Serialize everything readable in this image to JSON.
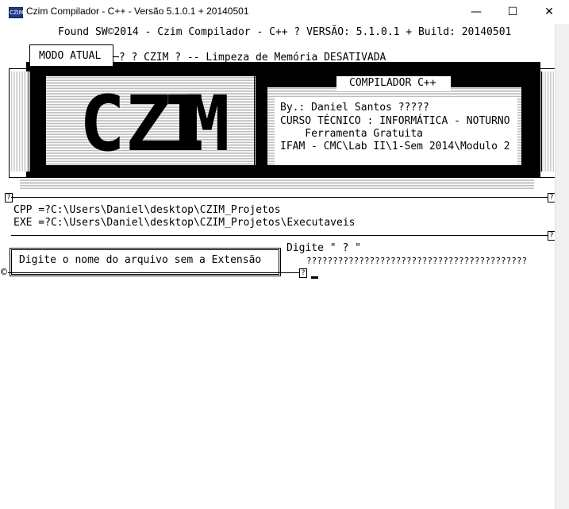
{
  "window": {
    "title": "Czim Compilador - C++ - Versão 5.1.0.1 + 20140501",
    "icon_label": "CZIM",
    "minimize": "—",
    "maximize": "☐",
    "close": "✕"
  },
  "header": {
    "found_line": "Found SW©2014 - Czim Compilador - C++ ? VERSÃO: 5.1.0.1 + Build: 20140501",
    "mode_label": "MODO ATUAL",
    "mode_status": "─? ? CZIM ? -- Limpeza de Memória DESATIVADA"
  },
  "banner": {
    "logo_letters": [
      "C",
      "Z",
      "I",
      "M"
    ],
    "compiler_tab": "COMPILADOR C++",
    "info_lines": [
      "By.: Daniel Santos ?????",
      "CURSO TÉCNICO : INFORMÁTICA - NOTURNO",
      "    Ferramenta Gratuita",
      "IFAM - CMC\\Lab II\\1-Sem 2014\\Modulo 2"
    ]
  },
  "paths": {
    "cpp": "CPP =?C:\\Users\\Daniel\\desktop\\CZIM_Projetos",
    "exe": "EXE =?C:\\Users\\Daniel\\desktop\\CZIM_Projetos\\Executaveis"
  },
  "prompt": {
    "instruction": "Digite o nome do arquivo sem a Extensão",
    "hint": "Digite \" ? \"",
    "input_mask": "??????????????????????????????????????????",
    "copyright_mark": "©",
    "corner_mark": "?"
  }
}
